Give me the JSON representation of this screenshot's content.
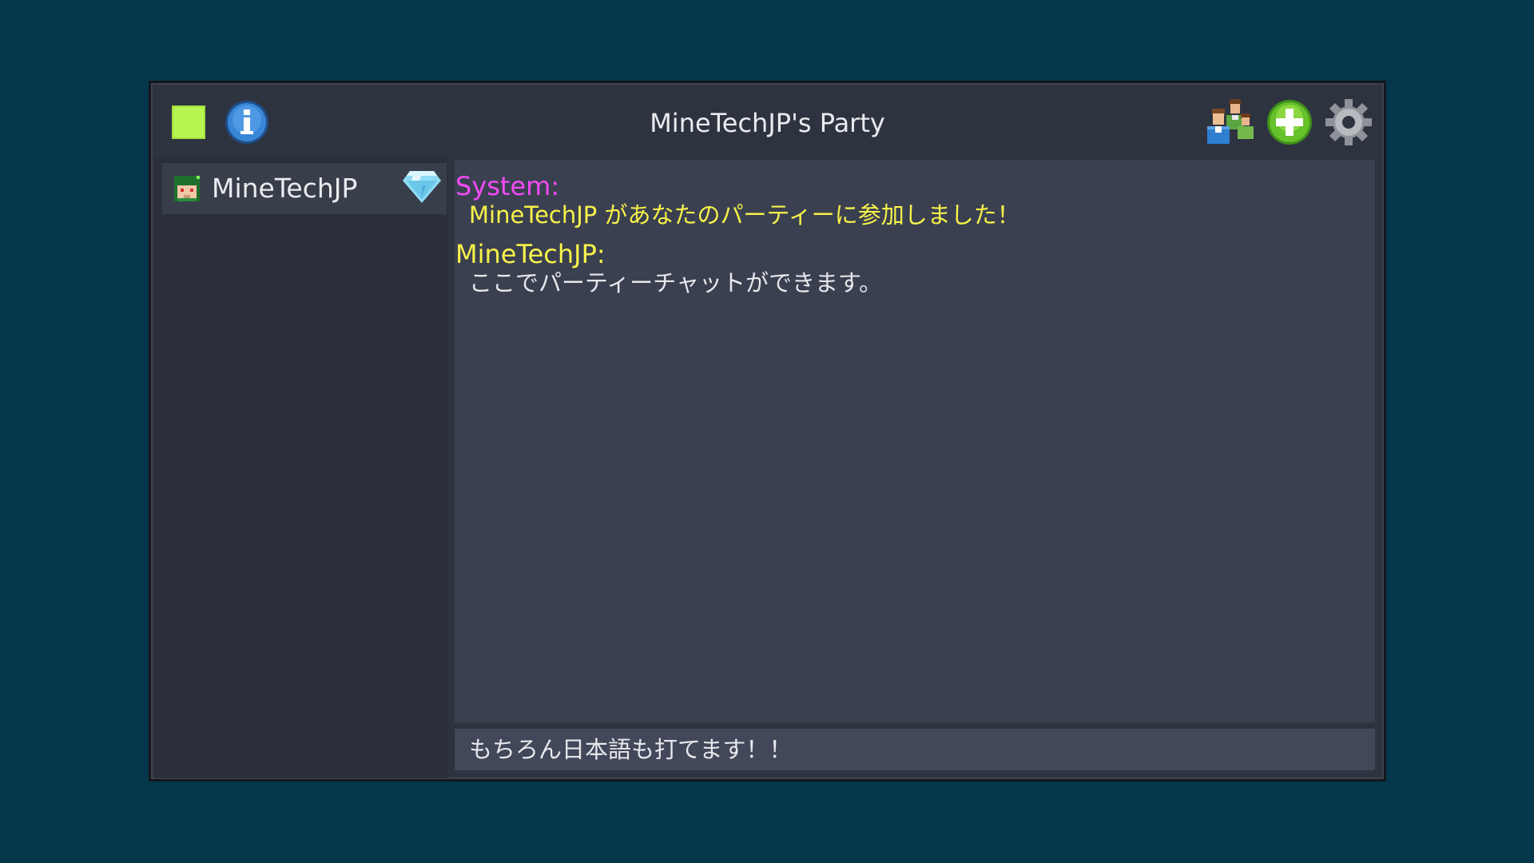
{
  "window": {
    "title": "MineTechJP's Party",
    "party_color": "#b7f450"
  },
  "toolbar": {
    "info_icon": "info-icon",
    "members_icon": "party-members-icon",
    "add_icon": "add-icon",
    "settings_icon": "gear-icon"
  },
  "members": [
    {
      "name": "MineTechJP",
      "rank_icon": "diamond-icon"
    }
  ],
  "messages": [
    {
      "sender": "System:",
      "text": "MineTechJP があなたのパーティーに参加しました！",
      "sender_color": "#f24bf4",
      "text_color": "#f7f24a"
    },
    {
      "sender": "MineTechJP:",
      "text": "ここでパーティーチャットができます。",
      "sender_color": "#f7f24a",
      "text_color": "#e6e8ec"
    }
  ],
  "input": {
    "value": "もちろん日本語も打てます！！"
  }
}
